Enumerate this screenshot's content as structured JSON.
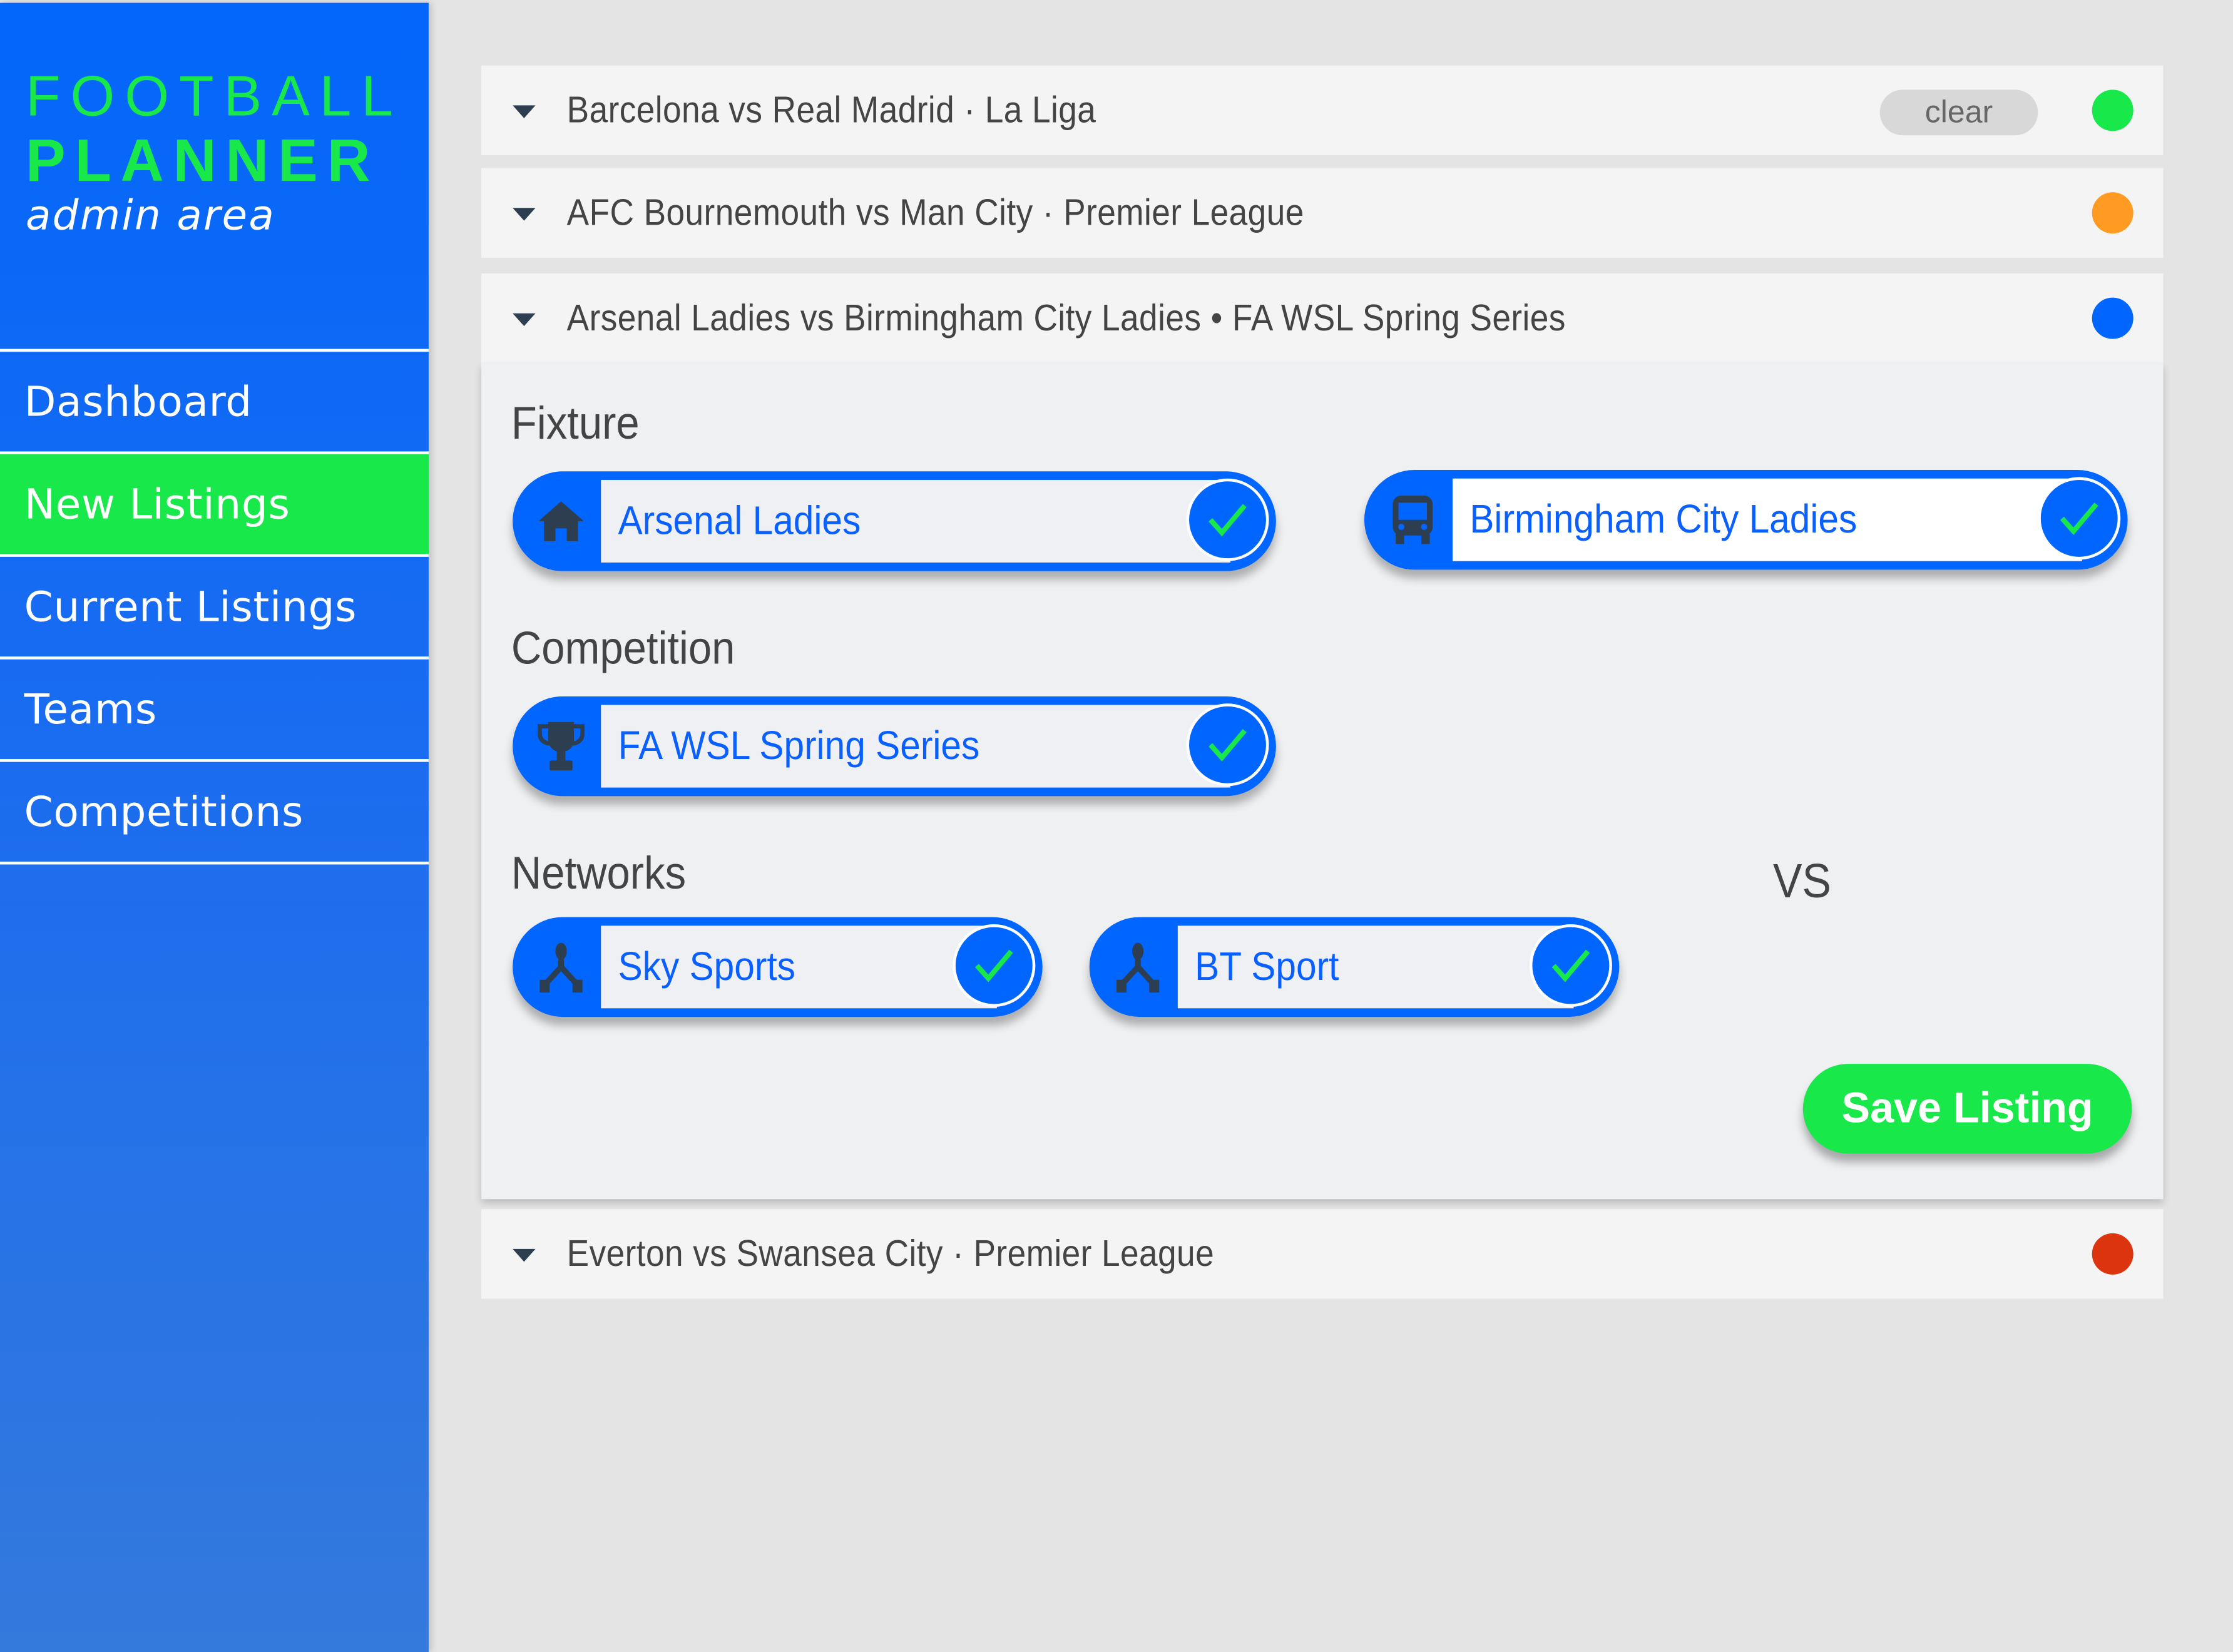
{
  "app": {
    "logo_line1": "FOOTBALL",
    "logo_line2": "PLANNER",
    "logo_line3": "admin area"
  },
  "sidebar": {
    "items": [
      {
        "label": "Dashboard",
        "active": false
      },
      {
        "label": "New Listings",
        "active": true
      },
      {
        "label": "Current Listings",
        "active": false
      },
      {
        "label": "Teams",
        "active": false
      },
      {
        "label": "Competitions",
        "active": false
      }
    ]
  },
  "listings": [
    {
      "title": "Barcelona vs Real Madrid · La Liga",
      "status_color": "#19e84b",
      "clear_label": "clear",
      "expanded": false
    },
    {
      "title": "AFC Bournemouth vs Man City · Premier League",
      "status_color": "#ff9a22",
      "expanded": false
    },
    {
      "title": "Arsenal Ladies vs Birmingham City Ladies • FA WSL Spring Series",
      "status_color": "#0066ff",
      "expanded": true
    },
    {
      "title": "Everton vs Swansea City · Premier League",
      "status_color": "#dd3410",
      "expanded": false
    }
  ],
  "editor": {
    "fixture_label": "Fixture",
    "home_team": {
      "value": "Arsenal Ladies",
      "icon": "home-icon",
      "confirmed": true
    },
    "vs_label": "VS",
    "away_team": {
      "value": "Birmingham City Ladies",
      "icon": "bus-icon",
      "confirmed": true
    },
    "competition_label": "Competition",
    "competition": {
      "value": "FA WSL Spring Series",
      "icon": "trophy-icon",
      "confirmed": true
    },
    "networks_label": "Networks",
    "networks": [
      {
        "value": "Sky Sports",
        "icon": "network-icon",
        "confirmed": true
      },
      {
        "value": "BT Sport",
        "icon": "network-icon",
        "confirmed": true
      }
    ],
    "save_label": "Save Listing"
  },
  "colors": {
    "brand_blue": "#0066ff",
    "brand_green": "#19e84b",
    "icon_dark": "#2c3e50"
  }
}
